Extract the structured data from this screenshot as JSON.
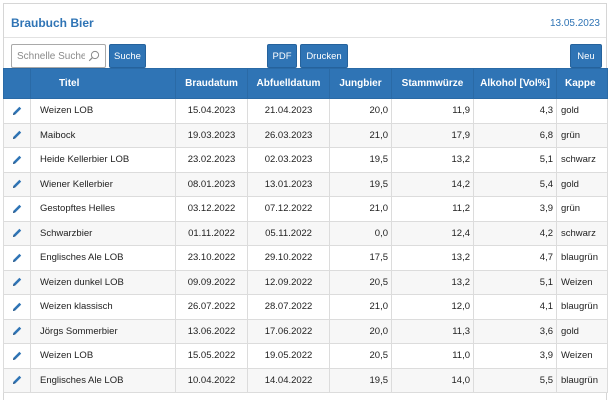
{
  "header": {
    "title": "Braubuch Bier",
    "date": "13.05.2023"
  },
  "toolbar": {
    "search_placeholder": "Schnelle Suche",
    "search_value": "",
    "search_label": "Suche",
    "pdf_label": "PDF",
    "print_label": "Drucken",
    "new_label": "Neu"
  },
  "colors": {
    "accent": "#2f74b5",
    "header_text": "#ffffff",
    "row_alt": "#f7f7f7"
  },
  "icons": {
    "search": "magnifier-icon",
    "edit": "pencil-icon"
  },
  "table": {
    "columns": [
      "Titel",
      "Braudatum",
      "Abfuelldatum",
      "Jungbier",
      "Stammwürze",
      "Alkohol [Vol%]",
      "Kappe"
    ],
    "rows": [
      {
        "titel": "Weizen LOB",
        "braudatum": "15.04.2023",
        "abfuelldatum": "21.04.2023",
        "jungbier": "20,0",
        "stammwuerze": "11,9",
        "alkohol": "4,3",
        "kappe": "gold"
      },
      {
        "titel": "Maibock",
        "braudatum": "19.03.2023",
        "abfuelldatum": "26.03.2023",
        "jungbier": "21,0",
        "stammwuerze": "17,9",
        "alkohol": "6,8",
        "kappe": "grün"
      },
      {
        "titel": "Heide Kellerbier LOB",
        "braudatum": "23.02.2023",
        "abfuelldatum": "02.03.2023",
        "jungbier": "19,5",
        "stammwuerze": "13,2",
        "alkohol": "5,1",
        "kappe": "schwarz"
      },
      {
        "titel": "Wiener Kellerbier",
        "braudatum": "08.01.2023",
        "abfuelldatum": "13.01.2023",
        "jungbier": "19,5",
        "stammwuerze": "14,2",
        "alkohol": "5,4",
        "kappe": "gold"
      },
      {
        "titel": "Gestopftes Helles",
        "braudatum": "03.12.2022",
        "abfuelldatum": "07.12.2022",
        "jungbier": "21,0",
        "stammwuerze": "11,2",
        "alkohol": "3,9",
        "kappe": "grün"
      },
      {
        "titel": "Schwarzbier",
        "braudatum": "01.11.2022",
        "abfuelldatum": "05.11.2022",
        "jungbier": "0,0",
        "stammwuerze": "12,4",
        "alkohol": "4,2",
        "kappe": "schwarz"
      },
      {
        "titel": "Englisches Ale LOB",
        "braudatum": "23.10.2022",
        "abfuelldatum": "29.10.2022",
        "jungbier": "17,5",
        "stammwuerze": "13,2",
        "alkohol": "4,7",
        "kappe": "blaugrün"
      },
      {
        "titel": "Weizen dunkel LOB",
        "braudatum": "09.09.2022",
        "abfuelldatum": "12.09.2022",
        "jungbier": "20,5",
        "stammwuerze": "13,2",
        "alkohol": "5,1",
        "kappe": "Weizen"
      },
      {
        "titel": "Weizen klassisch",
        "braudatum": "26.07.2022",
        "abfuelldatum": "28.07.2022",
        "jungbier": "21,0",
        "stammwuerze": "12,0",
        "alkohol": "4,1",
        "kappe": "blaugrün"
      },
      {
        "titel": "Jörgs Sommerbier",
        "braudatum": "13.06.2022",
        "abfuelldatum": "17.06.2022",
        "jungbier": "20,0",
        "stammwuerze": "11,3",
        "alkohol": "3,6",
        "kappe": "gold"
      },
      {
        "titel": "Weizen LOB",
        "braudatum": "15.05.2022",
        "abfuelldatum": "19.05.2022",
        "jungbier": "20,5",
        "stammwuerze": "11,0",
        "alkohol": "3,9",
        "kappe": "Weizen"
      },
      {
        "titel": "Englisches Ale LOB",
        "braudatum": "10.04.2022",
        "abfuelldatum": "14.04.2022",
        "jungbier": "19,5",
        "stammwuerze": "14,0",
        "alkohol": "5,5",
        "kappe": "blaugrün"
      }
    ]
  }
}
